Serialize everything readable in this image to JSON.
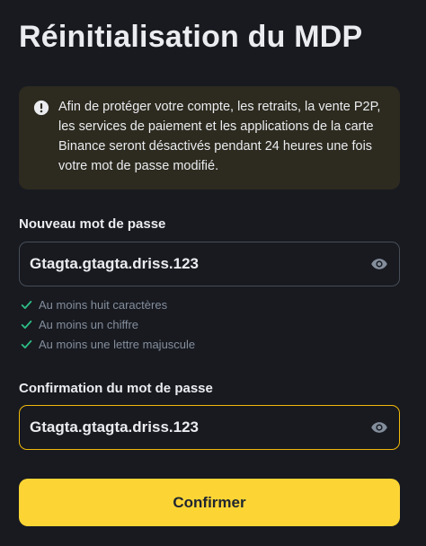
{
  "page": {
    "title": "Réinitialisation du MDP"
  },
  "alert": {
    "icon": "exclamation-circle-icon",
    "text": "Afin de protéger votre compte, les retraits, la vente P2P, les services de paiement et les applications de la carte Binance seront désactivés pendant 24 heures une fois votre mot de passe modifié."
  },
  "new_password": {
    "label": "Nouveau mot de passe",
    "value": "Gtagta.gtagta.driss.123",
    "toggle_icon": "eye-icon"
  },
  "requirements": {
    "items": [
      {
        "text": "Au moins huit caractères",
        "met": true
      },
      {
        "text": "Au moins un chiffre",
        "met": true
      },
      {
        "text": "Au moins une lettre majuscule",
        "met": true
      }
    ]
  },
  "confirm_password": {
    "label": "Confirmation du mot de passe",
    "value": "Gtagta.gtagta.driss.123",
    "toggle_icon": "eye-icon"
  },
  "submit": {
    "label": "Confirmer"
  },
  "colors": {
    "background": "#181A20",
    "accent": "#FCD535",
    "focus_border": "#F0B90B",
    "success": "#2EBD85",
    "alert_background": "#2D2A1F"
  }
}
